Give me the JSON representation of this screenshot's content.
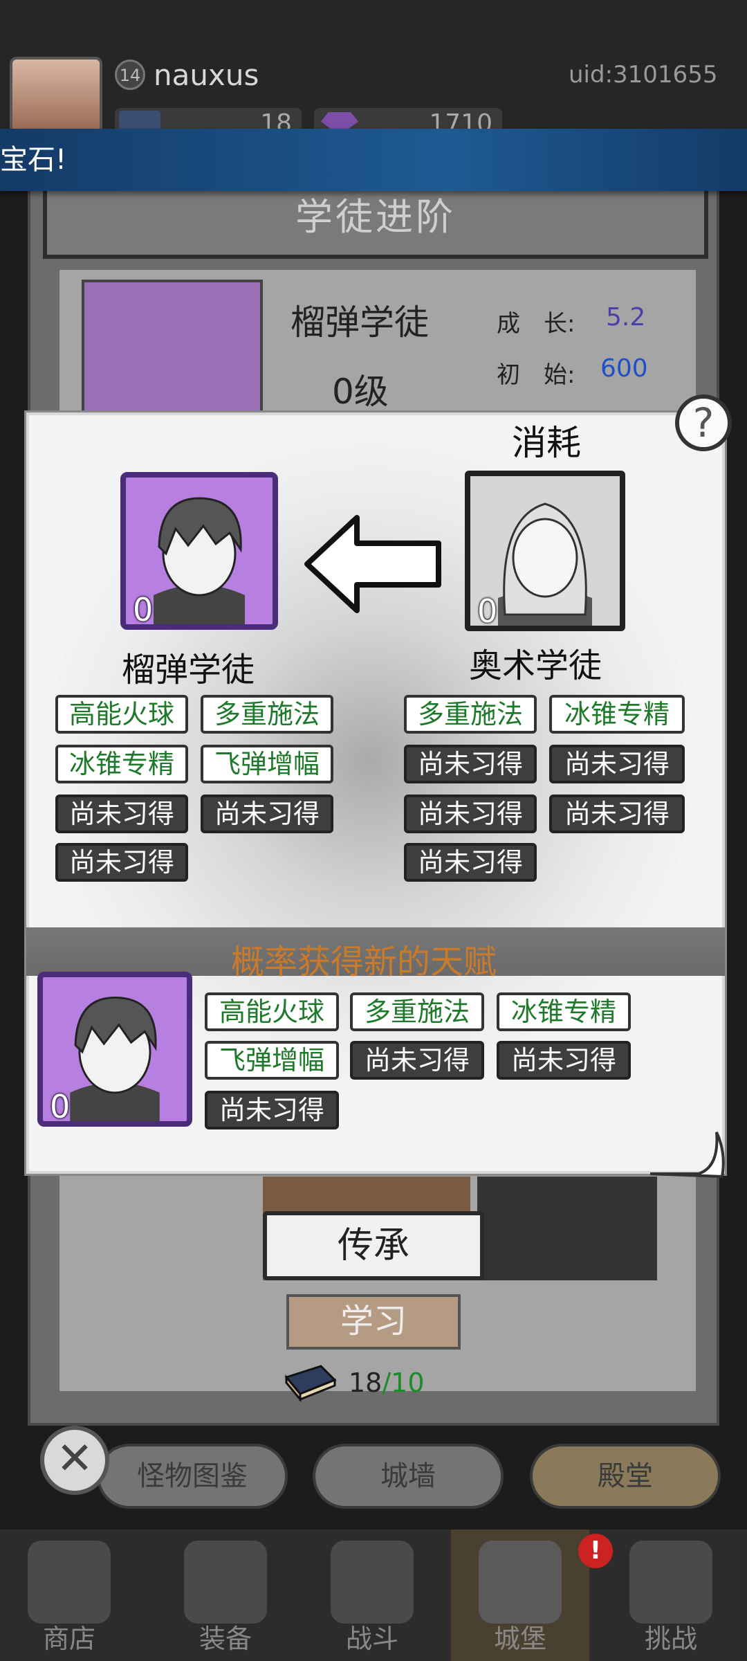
{
  "header": {
    "level": "14",
    "username": "nauxus",
    "uid": "uid:3101655",
    "books": "18",
    "gems": "1710"
  },
  "toast": {
    "text": "宝石!"
  },
  "panel": {
    "title": "学徒进阶",
    "hero_name": "榴弹学徒",
    "hero_level": "0级",
    "stats": [
      {
        "label": "成　长:",
        "value": "5.2"
      },
      {
        "label": "初　始:",
        "value": "600"
      }
    ]
  },
  "popup": {
    "consume_label": "消耗",
    "help_label": "?",
    "left": {
      "name": "榴弹学徒",
      "level": "0",
      "talents": [
        {
          "label": "高能火球",
          "learned": true
        },
        {
          "label": "多重施法",
          "learned": true
        },
        {
          "label": "冰锥专精",
          "learned": true
        },
        {
          "label": "飞弹增幅",
          "learned": true
        },
        {
          "label": "尚未习得",
          "learned": false
        },
        {
          "label": "尚未习得",
          "learned": false
        },
        {
          "label": "尚未习得",
          "learned": false
        }
      ]
    },
    "right": {
      "name": "奥术学徒",
      "level": "0",
      "talents": [
        {
          "label": "多重施法",
          "learned": true
        },
        {
          "label": "冰锥专精",
          "learned": true
        },
        {
          "label": "尚未习得",
          "learned": false
        },
        {
          "label": "尚未习得",
          "learned": false
        },
        {
          "label": "尚未习得",
          "learned": false
        },
        {
          "label": "尚未习得",
          "learned": false
        },
        {
          "label": "尚未习得",
          "learned": false
        }
      ]
    },
    "new_talent_title": "概率获得新的天赋",
    "result": {
      "level": "0",
      "talents": [
        {
          "label": "高能火球",
          "learned": true
        },
        {
          "label": "多重施法",
          "learned": true
        },
        {
          "label": "冰锥专精",
          "learned": true
        },
        {
          "label": "飞弹增幅",
          "learned": true
        },
        {
          "label": "尚未习得",
          "learned": false
        },
        {
          "label": "尚未习得",
          "learned": false
        },
        {
          "label": "尚未习得",
          "learned": false
        }
      ]
    }
  },
  "actions": {
    "inherit": "传承",
    "learn": "学习",
    "book_have": "18",
    "book_sep": "/",
    "book_need": "10"
  },
  "tabs": [
    "怪物图鉴",
    "城墙",
    "殿堂"
  ],
  "close_label": "✕",
  "nav": {
    "items": [
      {
        "label": "商店",
        "icon": "shop-icon"
      },
      {
        "label": "装备",
        "icon": "backpack-icon"
      },
      {
        "label": "战斗",
        "icon": "crossed-swords-icon"
      },
      {
        "label": "城堡",
        "icon": "castle-icon"
      },
      {
        "label": "挑战",
        "icon": "shield-icon"
      }
    ],
    "alert": "!"
  },
  "colors": {
    "learned_text": "#1e7a2a",
    "locked_bg": "#3e3e3e",
    "accent_orange": "#c97a2a",
    "portrait_purple": "#b77fe0"
  }
}
